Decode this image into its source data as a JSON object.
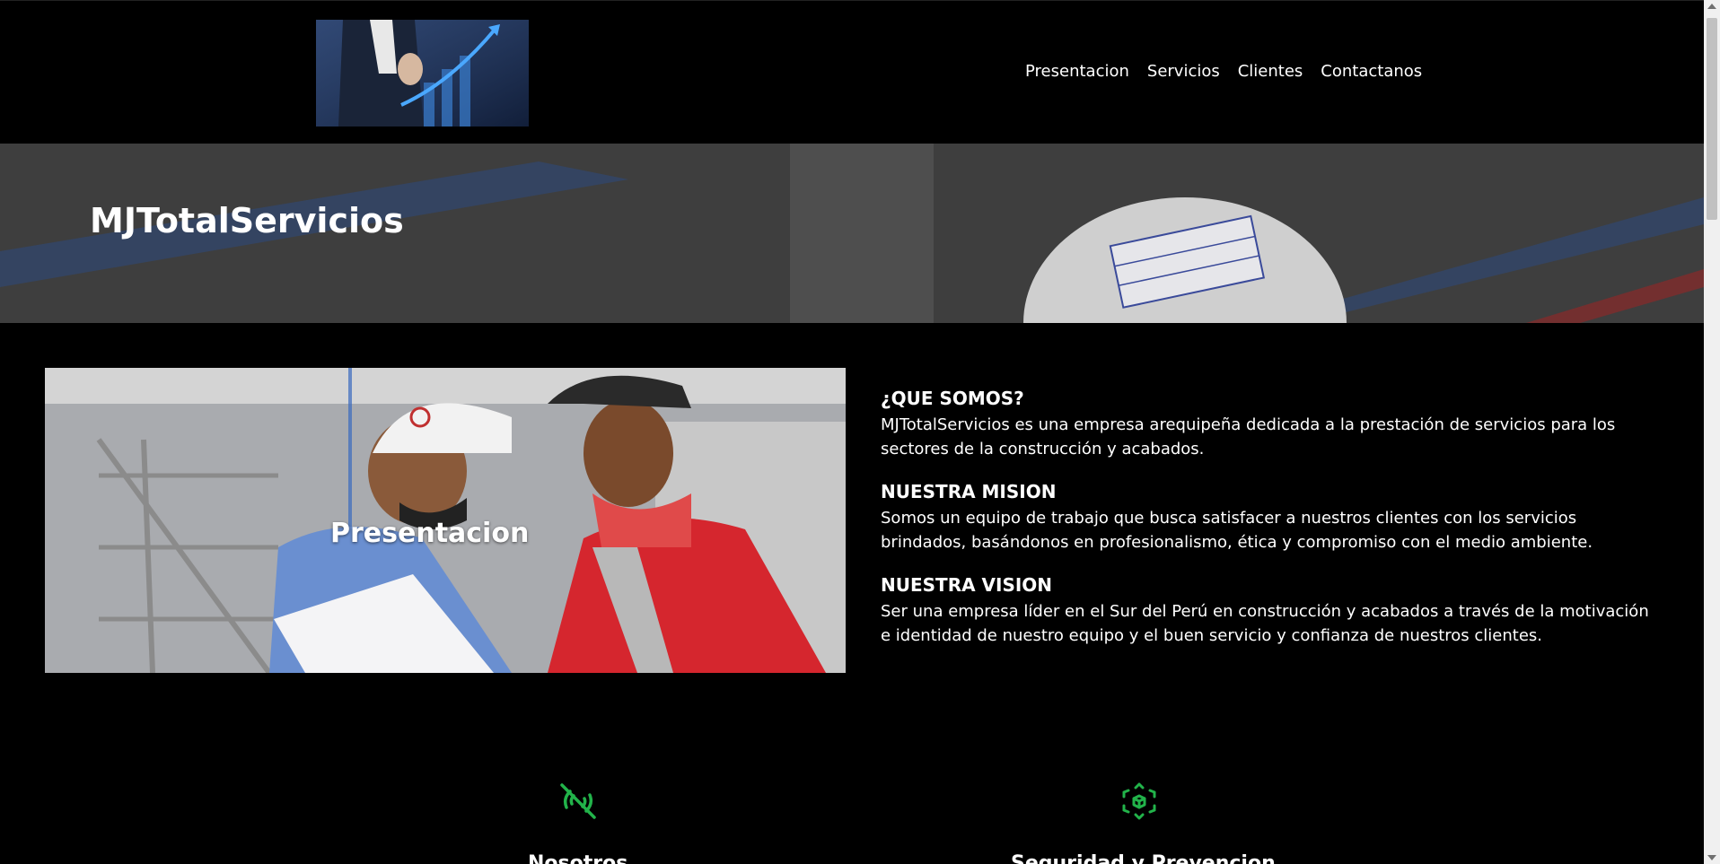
{
  "nav": {
    "items": [
      "Presentacion",
      "Servicios",
      "Clientes",
      "Contactanos"
    ]
  },
  "banner": {
    "title": "MJTotalServicios"
  },
  "presentation": {
    "image_label": "Presentacion"
  },
  "info": {
    "sections": [
      {
        "heading": "¿QUE SOMOS?",
        "text": "MJTotalServicios es una empresa arequipeña dedicada a la prestación de servicios para los sectores de la construcción y acabados."
      },
      {
        "heading": "NUESTRA MISION",
        "text": "Somos un equipo de trabajo que busca satisfacer a nuestros clientes con los servicios brindados, basándonos en profesionalismo, ética y compromiso con el medio ambiente."
      },
      {
        "heading": "NUESTRA VISION",
        "text": "Ser una empresa líder en el Sur del Perú en construcción y acabados a través de la motivación e identidad de nuestro equipo y el buen servicio y confianza de nuestros clientes."
      }
    ]
  },
  "features": [
    {
      "icon": "signal-off-icon",
      "title": "Nosotros"
    },
    {
      "icon": "cube-arrows-icon",
      "title": "Seguridad y Prevencion"
    }
  ],
  "colors": {
    "accent_green": "#22b34a",
    "background": "#000000",
    "text": "#ffffff"
  }
}
